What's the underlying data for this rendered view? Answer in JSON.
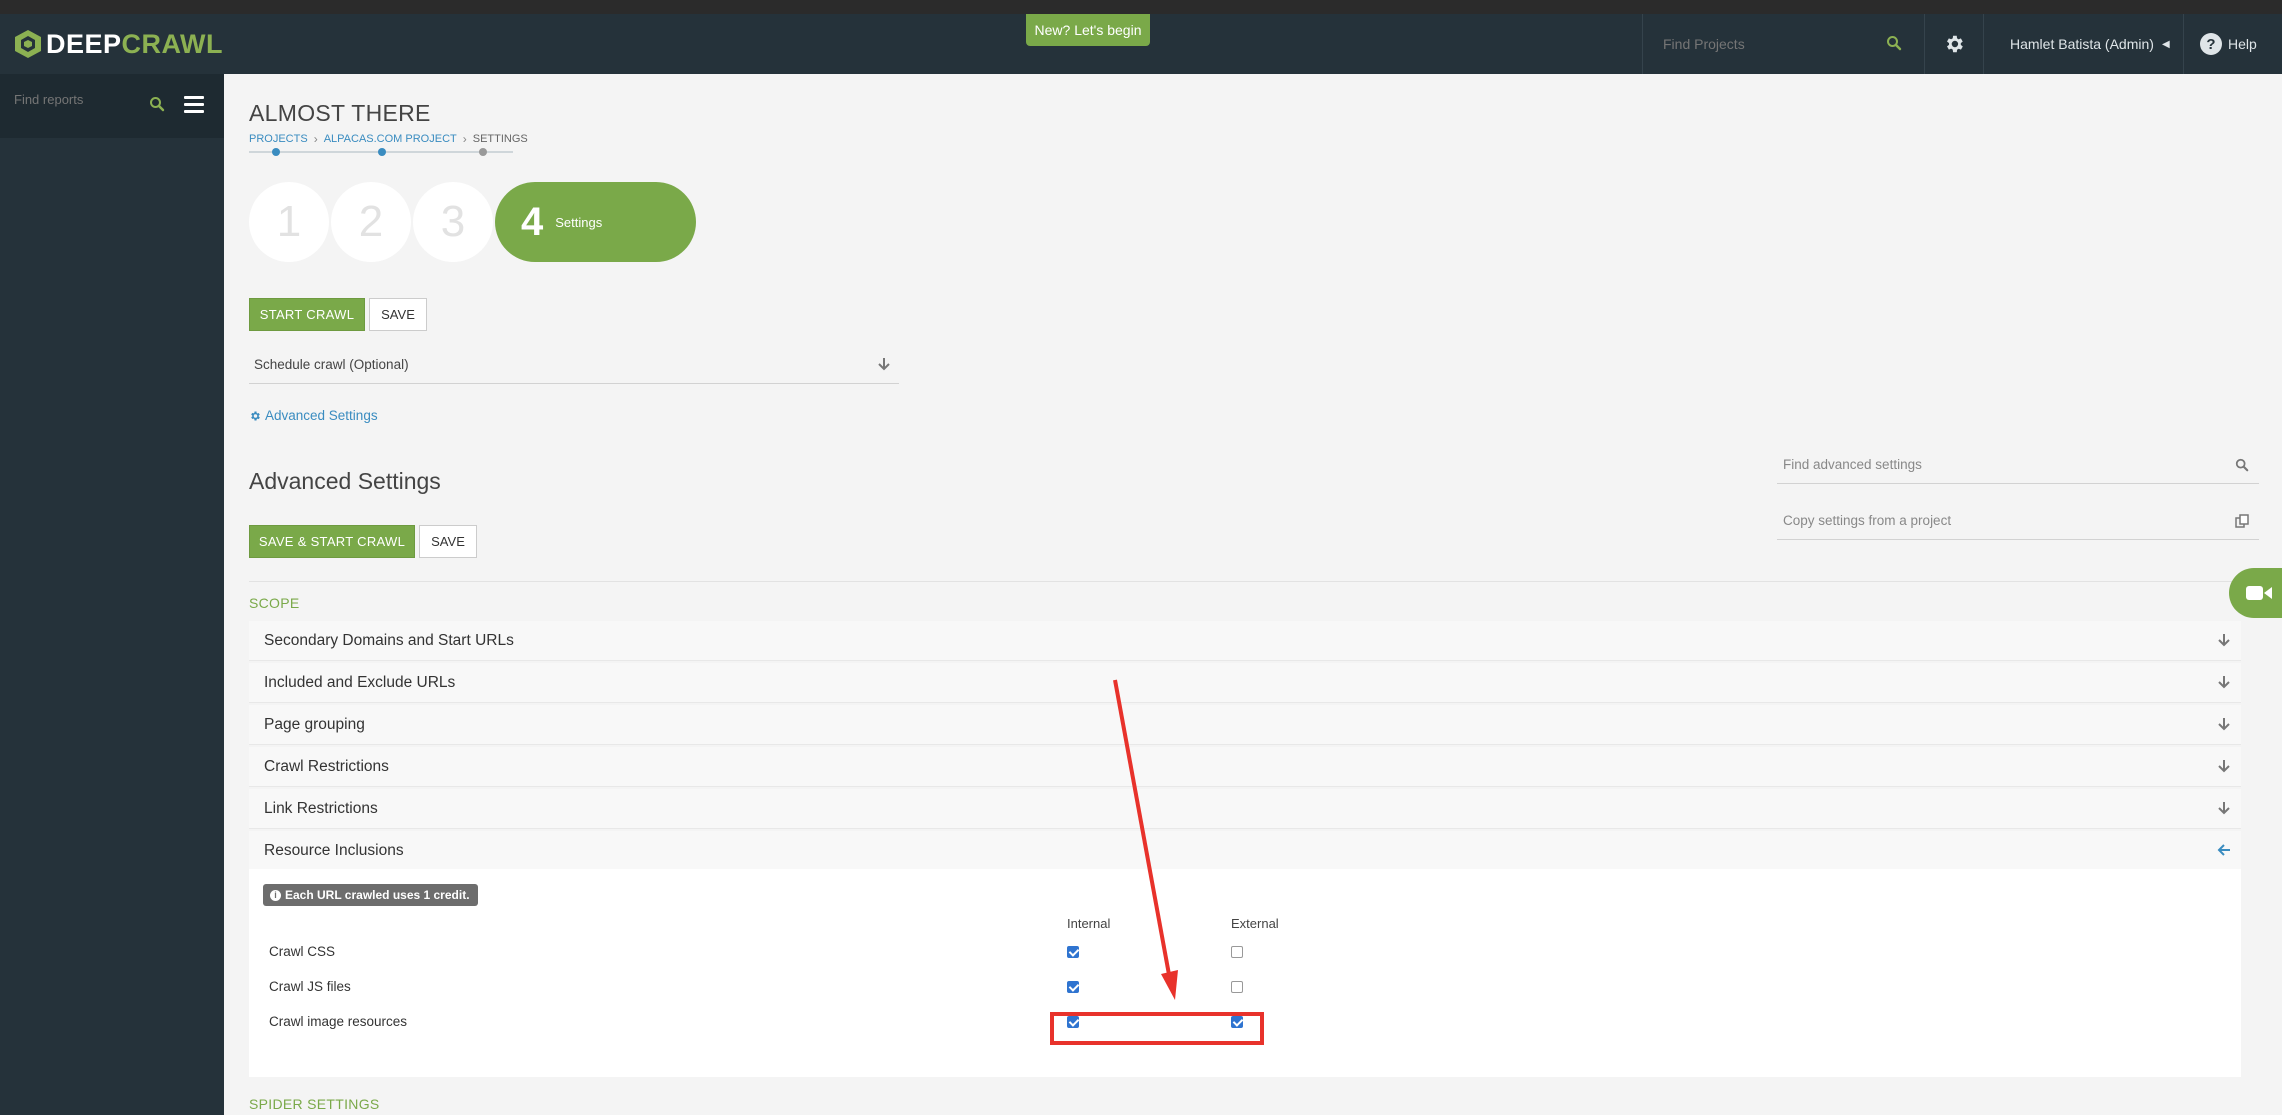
{
  "header": {
    "logo_deep": "DEEP",
    "logo_crawl": "CRAWL",
    "new_button": "New? Let's begin",
    "search_placeholder": "Find Projects",
    "user": "Hamlet Batista (Admin)",
    "help": "Help"
  },
  "sidebar": {
    "search_placeholder": "Find reports"
  },
  "page": {
    "title": "ALMOST THERE",
    "breadcrumb": [
      "PROJECTS",
      "ALPACAS.COM PROJECT",
      "SETTINGS"
    ],
    "steps": [
      "1",
      "2",
      "3"
    ],
    "active_step": {
      "number": "4",
      "label": "Settings"
    }
  },
  "actions": {
    "start_crawl": "START CRAWL",
    "save": "SAVE",
    "save_and_start": "SAVE & START CRAWL",
    "save2": "SAVE"
  },
  "schedule": {
    "label": "Schedule crawl (Optional)"
  },
  "advanced_link": "Advanced Settings",
  "advanced": {
    "title": "Advanced Settings",
    "find_placeholder": "Find advanced settings",
    "copy_placeholder": "Copy settings from a project"
  },
  "scope": {
    "label": "SCOPE",
    "sections": [
      "Secondary Domains and Start URLs",
      "Included and Exclude URLs",
      "Page grouping",
      "Crawl Restrictions",
      "Link Restrictions",
      "Resource Inclusions"
    ]
  },
  "resource_inclusions": {
    "credit_note": "Each URL crawled uses 1 credit.",
    "col_internal": "Internal",
    "col_external": "External",
    "rows": [
      {
        "label": "Crawl CSS",
        "internal": true,
        "external": false
      },
      {
        "label": "Crawl JS files",
        "internal": true,
        "external": false
      },
      {
        "label": "Crawl image resources",
        "internal": true,
        "external": true
      }
    ]
  },
  "spider": {
    "label": "SPIDER SETTINGS"
  },
  "colors": {
    "brand_green": "#7aa949",
    "header_bg": "#25323a",
    "link_blue": "#3a8cc0",
    "annotation_red": "#e8322b"
  }
}
